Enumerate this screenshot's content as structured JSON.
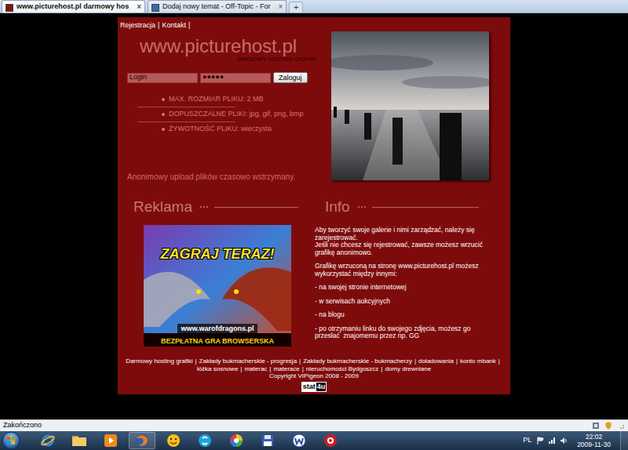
{
  "browser": {
    "tabs": [
      {
        "label": "www.picturehost.pl darmowy hos",
        "close": "×",
        "selected": true
      },
      {
        "label": "Dodaj nowy temat - Off-Topic - For",
        "close": "×",
        "selected": false
      }
    ],
    "new_tab": "+"
  },
  "page": {
    "nav": {
      "links": [
        "Rejestracja",
        "Kontakt"
      ],
      "separator": "|"
    },
    "logo": {
      "title": "www.picturehost.pl",
      "subtitle": "DARMOWY HOSTING GRAFIKI"
    },
    "login": {
      "user": "Login",
      "password": "●●●●●",
      "button": "Zaloguj"
    },
    "features": [
      "MAX. ROZMIAR PLIKU: 2 MB",
      "DOPUSZCZALNE PLIKI: jpg, gif, png, bmp",
      "ŻYWOTNOŚĆ PLIKU: wieczysta"
    ],
    "notice": "Anonimowy upload plików czasowo wstrzymany.",
    "ad": {
      "heading": "Reklama",
      "headline": "ZAGRAJ TERAZ!",
      "url": "www.warofdragons.pl",
      "tagline": "BEZPŁATNA GRA BROWSERSKA"
    },
    "info": {
      "heading": "Info",
      "paragraphs": [
        [
          "Aby tworzyć swoje galerie i nimi zarządzać, należy się zarejestrować.",
          "Jeśli nie chcesz się rejestrować, zawsze możesz wrzucić grafikę anonimowo."
        ],
        [
          "Grafikę wrzuconą na stronę www.picturehost.pl możesz wykorzystać między innymi:"
        ],
        [
          "- na swojej stronie internetowej"
        ],
        [
          "- w serwisach aukcyjnych"
        ],
        [
          "- na blogu"
        ],
        [
          "- po otrzymaniu linku do swojego zdjęcia, możesz go przesłać  znajomemu przez np. GG"
        ]
      ]
    },
    "footer": {
      "links": [
        "Darmowy hosting grafiki",
        "Zakłady bukmacherskie - progresja",
        "Zakłady bukmacherskie - bukmacherzy",
        "doładowania",
        "konto mbank",
        "łóżka sosnowe",
        "materac",
        "materace",
        "nieruchomości Bydgoszcz",
        "domy drewniane"
      ],
      "separator": "|",
      "copyright": "Copyright VIPigeon 2008 - 2009",
      "counter": [
        "stat",
        "4u"
      ]
    }
  },
  "status_bar": {
    "text": "Zakończono"
  },
  "taskbar": {
    "language": "PL",
    "time": "22:02",
    "date": "2009-11-30"
  }
}
